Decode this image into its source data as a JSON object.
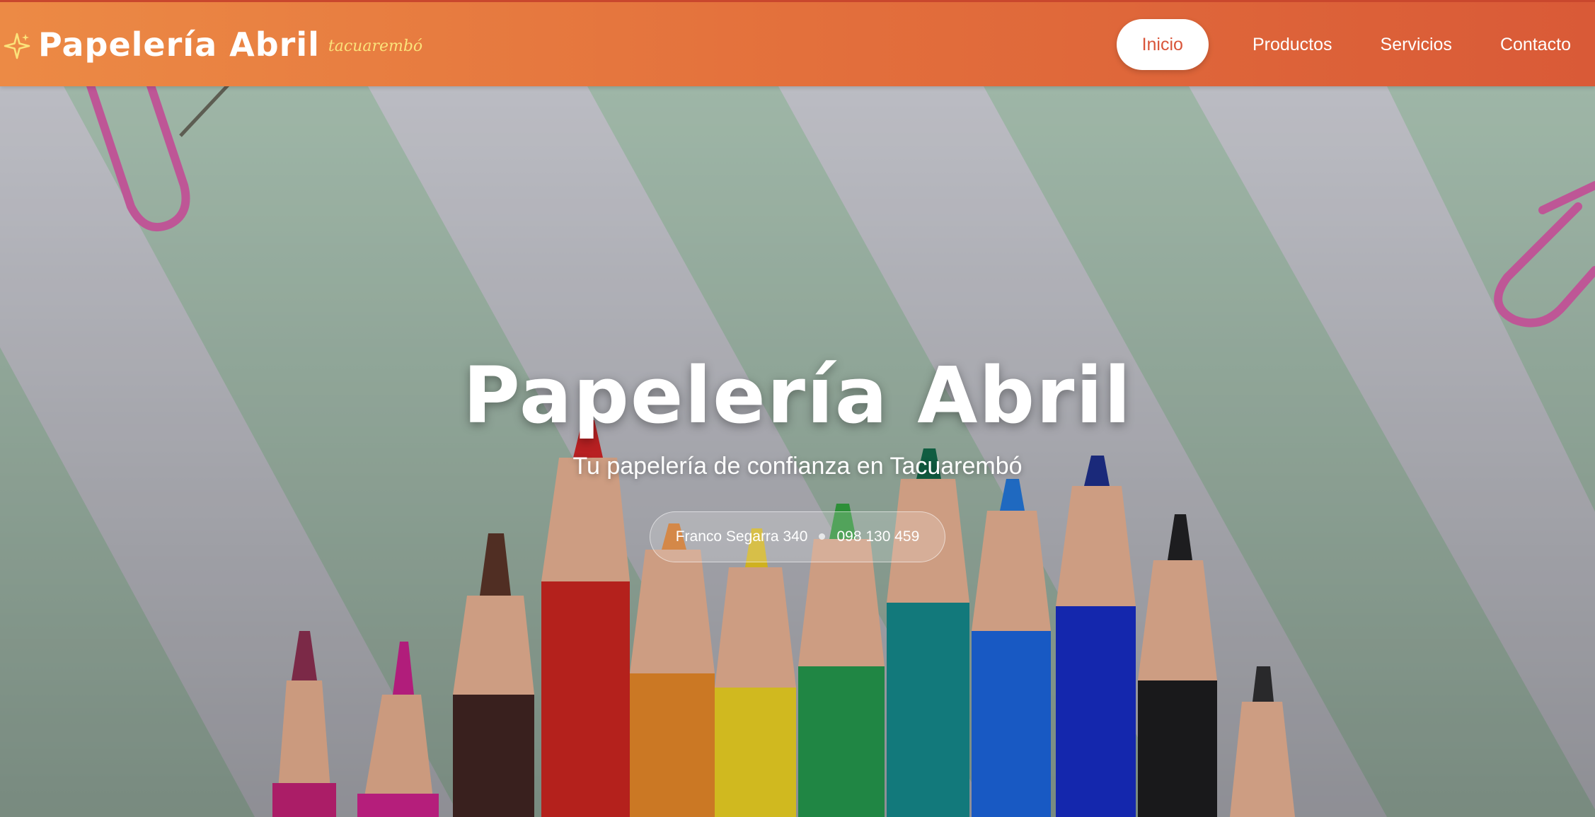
{
  "navbar": {
    "brand_name": "Papelería Abril",
    "brand_city": "tacuarembó",
    "brand_icon": "sparkle-icon",
    "items": [
      {
        "label": "Inicio",
        "active": true
      },
      {
        "label": "Productos",
        "active": false
      },
      {
        "label": "Servicios",
        "active": false
      },
      {
        "label": "Contacto",
        "active": false
      }
    ]
  },
  "hero": {
    "title": "Papelería Abril",
    "subtitle": "Tu papelería de confianza en Tacuarembó",
    "address": "Franco Segarra 340",
    "phone": "098 130 459",
    "background": "colored-pencils-photo"
  },
  "colors": {
    "nav_start": "#ec8a45",
    "nav_end": "#d95a37",
    "accent": "#d9553a",
    "brand_city": "#fbe27a"
  }
}
